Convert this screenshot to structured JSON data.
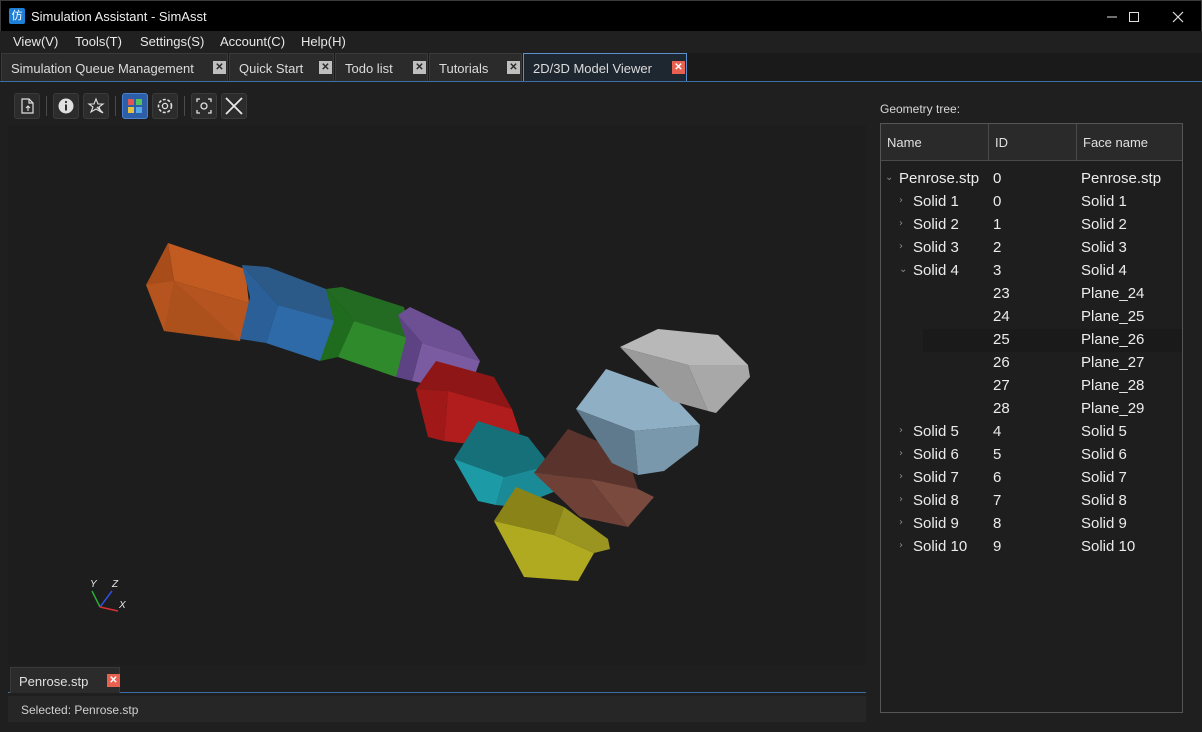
{
  "window": {
    "title": "Simulation Assistant - SimAsst",
    "icon_glyph": "仿",
    "controls": [
      "minimize-icon",
      "maximize-icon",
      "close-icon"
    ]
  },
  "menu": {
    "items": [
      "View(V)",
      "Tools(T)",
      "Settings(S)",
      "Account(C)",
      "Help(H)"
    ]
  },
  "tabs": [
    {
      "label": "Simulation Queue Management",
      "active": false
    },
    {
      "label": "Quick Start",
      "active": false
    },
    {
      "label": "Todo list",
      "active": false
    },
    {
      "label": "Tutorials",
      "active": false
    },
    {
      "label": "2D/3D Model Viewer",
      "active": true
    }
  ],
  "toolbar": {
    "buttons": [
      "import-file-icon",
      "info-icon",
      "magic-select-icon",
      "color-mode-icon",
      "settings-icon",
      "screenshot-icon",
      "close-model-icon"
    ],
    "active": "color-mode-icon"
  },
  "viewport": {
    "axes": {
      "y": "Y",
      "z": "Z",
      "x": "X"
    },
    "solid_colors": [
      "#b5541e",
      "#2e6aa8",
      "#2f8a2c",
      "#7a5aa0",
      "#b11c1c",
      "#1c9aa6",
      "#6e4036",
      "#b0aa20",
      "#8eafc4",
      "#b8b8b8"
    ]
  },
  "bottom_tab": {
    "label": "Penrose.stp"
  },
  "status": {
    "text": "Selected: Penrose.stp"
  },
  "tree": {
    "label": "Geometry tree:",
    "columns": [
      "Name",
      "ID",
      "Face name"
    ],
    "rows": [
      {
        "name": "Penrose.stp",
        "id": "0",
        "face": "Penrose.stp",
        "level": 0,
        "expand": "open"
      },
      {
        "name": "Solid 1",
        "id": "0",
        "face": "Solid 1",
        "level": 1,
        "expand": "closed"
      },
      {
        "name": "Solid 2",
        "id": "1",
        "face": "Solid 2",
        "level": 1,
        "expand": "closed"
      },
      {
        "name": "Solid 3",
        "id": "2",
        "face": "Solid 3",
        "level": 1,
        "expand": "closed"
      },
      {
        "name": "Solid 4",
        "id": "3",
        "face": "Solid 4",
        "level": 1,
        "expand": "open"
      },
      {
        "name": "",
        "id": "23",
        "face": "Plane_24",
        "level": 2,
        "expand": "none"
      },
      {
        "name": "",
        "id": "24",
        "face": "Plane_25",
        "level": 2,
        "expand": "none"
      },
      {
        "name": "",
        "id": "25",
        "face": "Plane_26",
        "level": 2,
        "expand": "none",
        "selected": true
      },
      {
        "name": "",
        "id": "26",
        "face": "Plane_27",
        "level": 2,
        "expand": "none"
      },
      {
        "name": "",
        "id": "27",
        "face": "Plane_28",
        "level": 2,
        "expand": "none"
      },
      {
        "name": "",
        "id": "28",
        "face": "Plane_29",
        "level": 2,
        "expand": "none"
      },
      {
        "name": "Solid 5",
        "id": "4",
        "face": "Solid 5",
        "level": 1,
        "expand": "closed"
      },
      {
        "name": "Solid 6",
        "id": "5",
        "face": "Solid 6",
        "level": 1,
        "expand": "closed"
      },
      {
        "name": "Solid 7",
        "id": "6",
        "face": "Solid 7",
        "level": 1,
        "expand": "closed"
      },
      {
        "name": "Solid 8",
        "id": "7",
        "face": "Solid 8",
        "level": 1,
        "expand": "closed"
      },
      {
        "name": "Solid 9",
        "id": "8",
        "face": "Solid 9",
        "level": 1,
        "expand": "closed"
      },
      {
        "name": "Solid 10",
        "id": "9",
        "face": "Solid 10",
        "level": 1,
        "expand": "closed"
      }
    ]
  }
}
